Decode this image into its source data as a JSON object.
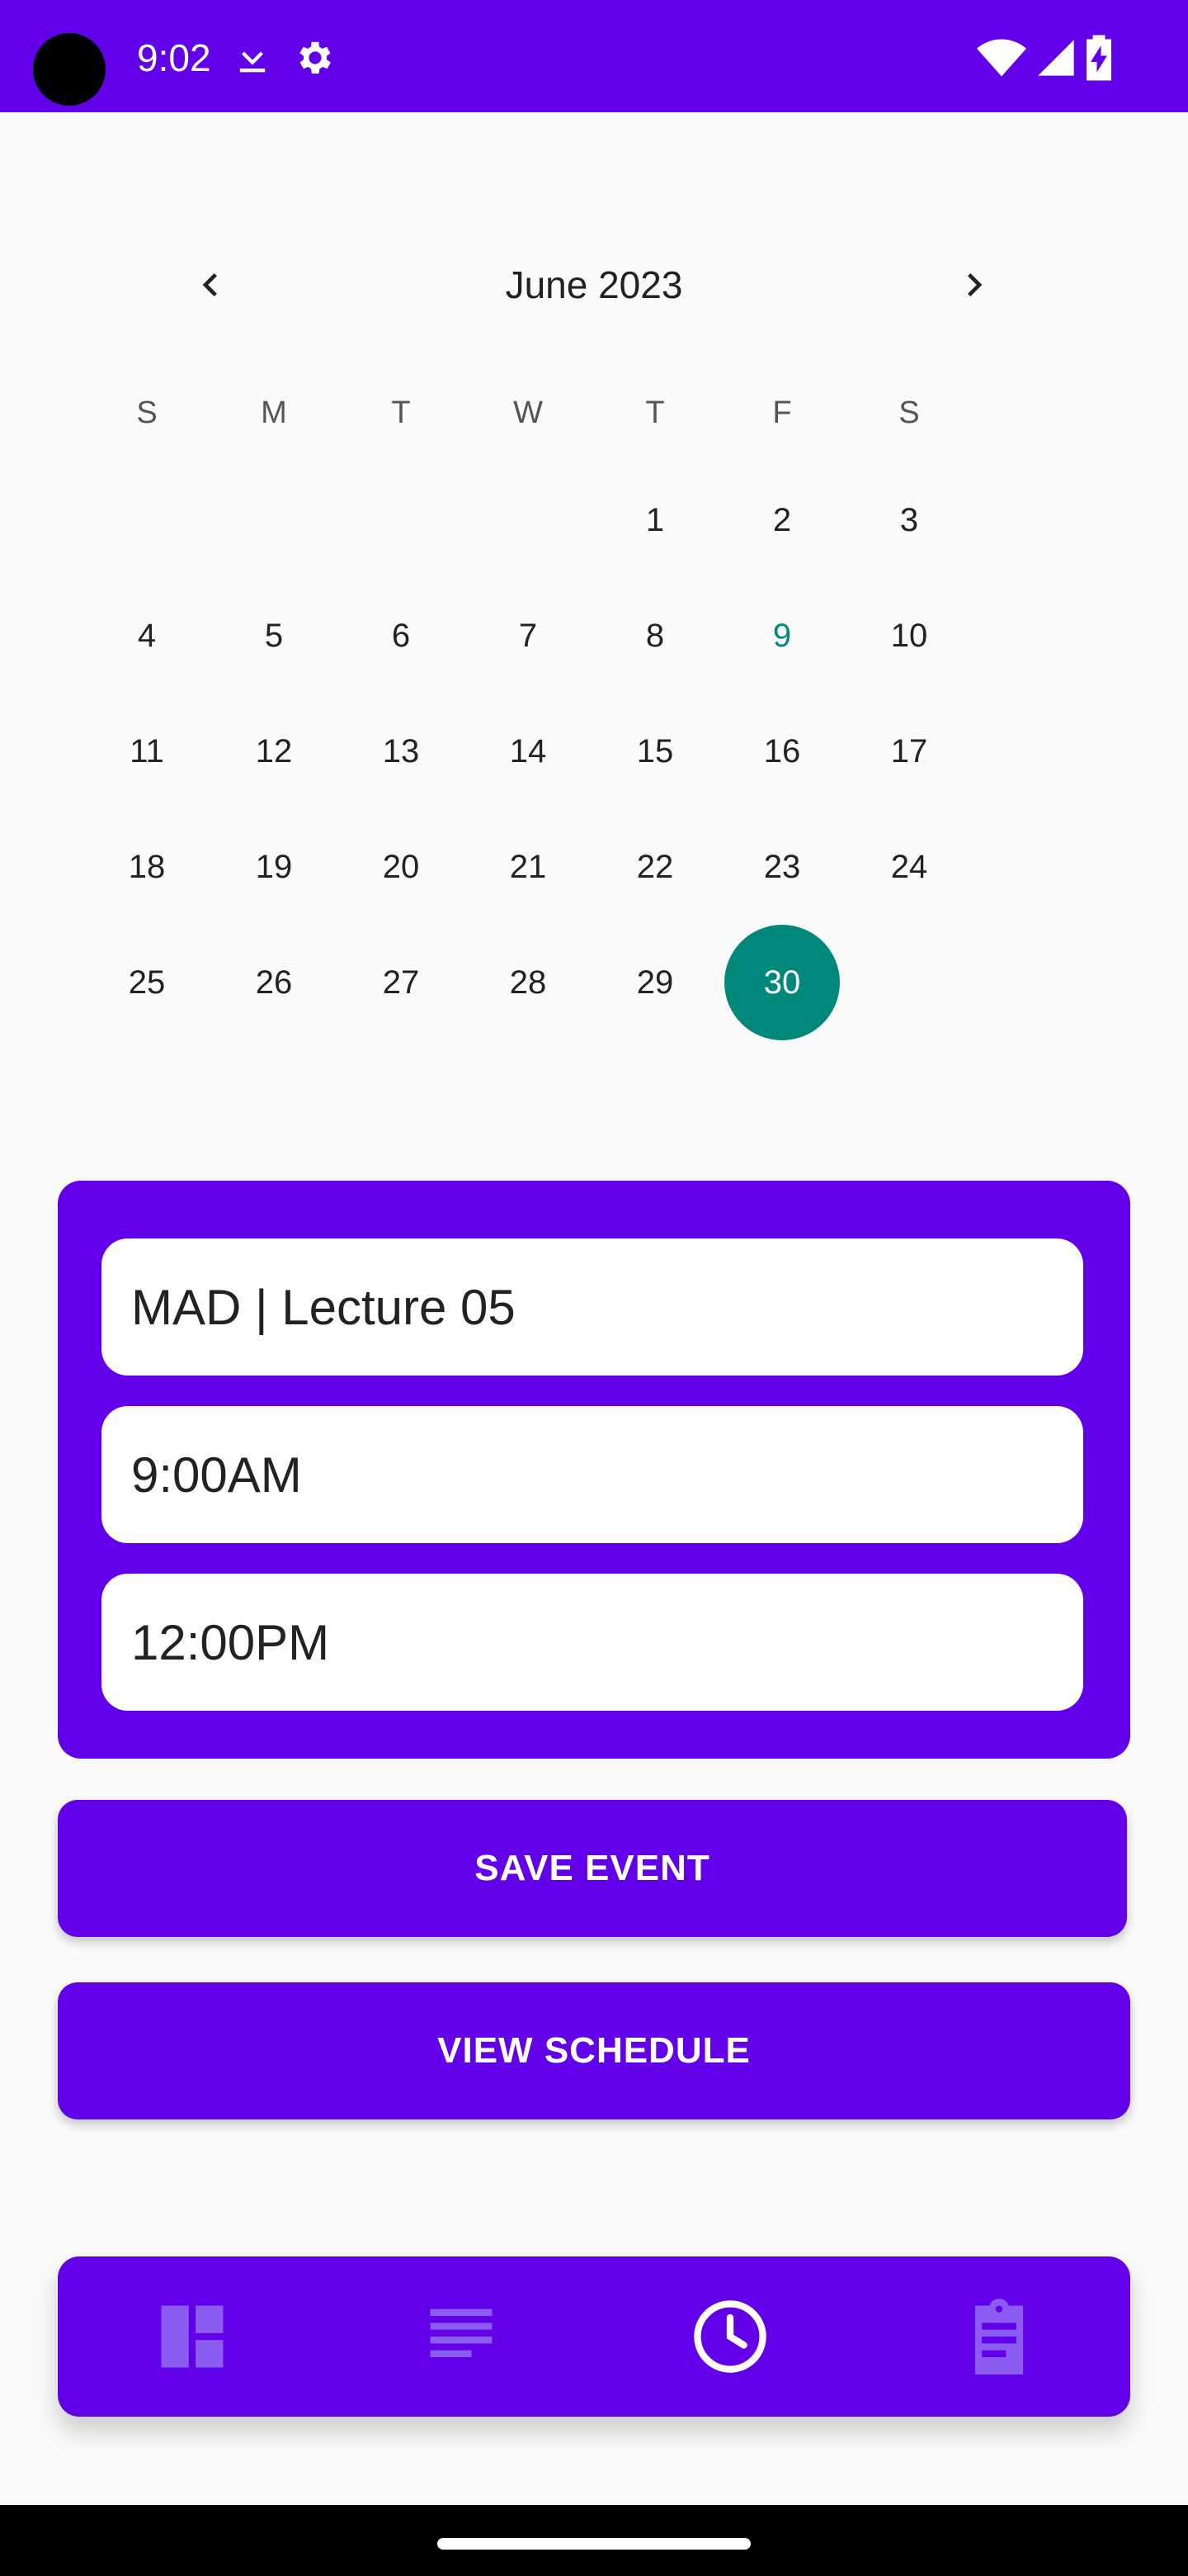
{
  "status_bar": {
    "time": "9:02",
    "background": "#6200ea",
    "icons": [
      "download-icon",
      "settings-gear-icon",
      "wifi-icon",
      "signal-icon",
      "battery-charging-icon"
    ]
  },
  "calendar": {
    "month_title": "June 2023",
    "weekdays": [
      "S",
      "M",
      "T",
      "W",
      "T",
      "F",
      "S"
    ],
    "weeks": [
      [
        "",
        "",
        "",
        "",
        "1",
        "2",
        "3"
      ],
      [
        "4",
        "5",
        "6",
        "7",
        "8",
        "9",
        "10"
      ],
      [
        "11",
        "12",
        "13",
        "14",
        "15",
        "16",
        "17"
      ],
      [
        "18",
        "19",
        "20",
        "21",
        "22",
        "23",
        "24"
      ],
      [
        "25",
        "26",
        "27",
        "28",
        "29",
        "30",
        ""
      ]
    ],
    "today": "9",
    "selected": "30",
    "accent_color": "#00897b",
    "prev_icon": "chevron-left-icon",
    "next_icon": "chevron-right-icon"
  },
  "event_form": {
    "title_value": "MAD | Lecture 05",
    "start_time_value": "9:00AM",
    "end_time_value": "12:00PM"
  },
  "actions": {
    "save_label": "SAVE EVENT",
    "view_label": "VIEW SCHEDULE"
  },
  "bottom_nav": {
    "items": [
      {
        "icon": "dashboard-icon",
        "active": false
      },
      {
        "icon": "list-icon",
        "active": false
      },
      {
        "icon": "clock-icon",
        "active": true
      },
      {
        "icon": "clipboard-icon",
        "active": false
      }
    ],
    "inactive_color": "#8a5cf0",
    "active_color": "#ffffff"
  },
  "colors": {
    "primary": "#6200ea",
    "background": "#fafafa"
  }
}
